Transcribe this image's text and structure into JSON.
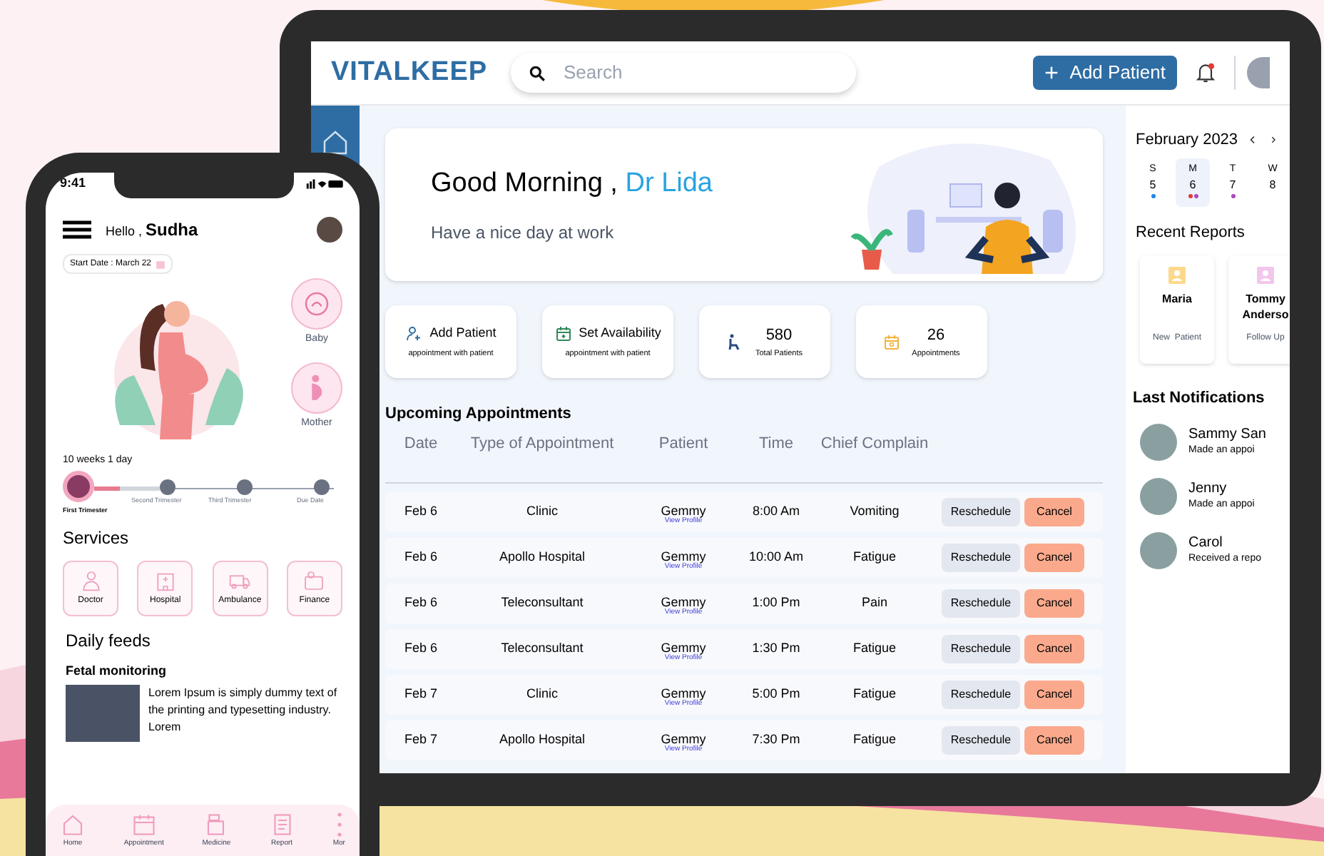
{
  "tablet": {
    "logo": "VITALKEEP",
    "search": {
      "placeholder": "Search"
    },
    "add_button": "Add Patient",
    "greeting": {
      "text": "Good Morning ,",
      "name": "Dr Lida",
      "subtitle": "Have a nice day at work"
    },
    "quick_cards": [
      {
        "kind": "action",
        "title": "Add Patient",
        "caption": "appointment with patient"
      },
      {
        "kind": "action",
        "title": "Set Availability",
        "caption": "appointment with patient"
      },
      {
        "kind": "stat",
        "title": "580",
        "caption": "Total Patients"
      },
      {
        "kind": "stat",
        "title": "26",
        "caption": "Appointments"
      }
    ],
    "appointments": {
      "title": "Upcoming Appointments",
      "columns": [
        "Date",
        "Type of Appointment",
        "Patient",
        "Time",
        "Chief Complain"
      ],
      "rows": [
        {
          "date": "Feb 6",
          "type": "Clinic",
          "patient": "Gemmy",
          "link": "View Profile",
          "time": "8:00 Am",
          "complaint": "Vomiting",
          "actions": [
            "Reschedule",
            "Cancel"
          ]
        },
        {
          "date": "Feb 6",
          "type": "Apollo Hospital",
          "patient": "Gemmy",
          "link": "View Profile",
          "time": "10:00 Am",
          "complaint": "Fatigue",
          "actions": [
            "Reschedule",
            "Cancel"
          ]
        },
        {
          "date": "Feb 6",
          "type": "Teleconsultant",
          "patient": "Gemmy",
          "link": "View Profile",
          "time": "1:00 Pm",
          "complaint": "Pain",
          "actions": [
            "Reschedule",
            "Cancel"
          ]
        },
        {
          "date": "Feb 6",
          "type": "Teleconsultant",
          "patient": "Gemmy",
          "link": "View Profile",
          "time": "1:30 Pm",
          "complaint": "Fatigue",
          "actions": [
            "Reschedule",
            "Cancel"
          ]
        },
        {
          "date": "Feb 7",
          "type": "Clinic",
          "patient": "Gemmy",
          "link": "View Profile",
          "time": "5:00 Pm",
          "complaint": "Fatigue",
          "actions": [
            "Reschedule",
            "Cancel"
          ]
        },
        {
          "date": "Feb 7",
          "type": "Apollo Hospital",
          "patient": "Gemmy",
          "link": "View Profile",
          "time": "7:30 Pm",
          "complaint": "Fatigue",
          "actions": [
            "Reschedule",
            "Cancel"
          ]
        }
      ]
    },
    "calendar": {
      "month": "February",
      "year": "2023",
      "days": [
        {
          "weekday": "S",
          "day": "5",
          "selected": false,
          "dots": [
            {
              "color": "#1e88e5"
            }
          ]
        },
        {
          "weekday": "M",
          "day": "6",
          "selected": true,
          "dots": [
            {
              "color": "#e53935"
            },
            {
              "color": "#ab47bc"
            }
          ]
        },
        {
          "weekday": "T",
          "day": "7",
          "selected": false,
          "dots": [
            {
              "color": "#ab47bc"
            }
          ]
        },
        {
          "weekday": "W",
          "day": "8",
          "selected": false
        }
      ]
    },
    "reports": {
      "title": "Recent Reports",
      "items": [
        {
          "name": "Maria",
          "tag": "New  Patient",
          "color": "#fcd98a"
        },
        {
          "name": "Tommy Anderso",
          "tag": "Follow Up",
          "color": "#f3c6ec"
        }
      ]
    },
    "notifications": {
      "title": "Last Notifications",
      "items": [
        {
          "name": "Sammy San",
          "message": "Made an appoi"
        },
        {
          "name": "Jenny",
          "message": "Made an appoi"
        },
        {
          "name": "Carol",
          "message": "Received a repo"
        }
      ]
    }
  },
  "phone": {
    "time": "9:41",
    "greeting": "Hello ,",
    "user": "Sudha",
    "start_date": "Start Date : March 22",
    "side_items": [
      {
        "label": "Baby"
      },
      {
        "label": "Mother"
      }
    ],
    "progress_label": "10 weeks 1 day",
    "level": 0.4,
    "stages": [
      {
        "label": "First Trimester",
        "selected": true
      },
      {
        "label": "Second Trimester",
        "selected": false
      },
      {
        "label": "Third Trimester",
        "selected": false
      },
      {
        "label": "Due Date",
        "selected": false
      }
    ],
    "services_title": "Services",
    "services": [
      "Doctor",
      "Hospital",
      "Ambulance",
      "Finance"
    ],
    "feeds_title": "Daily feeds",
    "feed": {
      "title": "Fetal monitoring",
      "text": "Lorem Ipsum is simply dummy text of the printing and typesetting industry. Lorem"
    },
    "nav": [
      "Home",
      "Appointment",
      "Medicine",
      "Report",
      "Mor"
    ]
  }
}
